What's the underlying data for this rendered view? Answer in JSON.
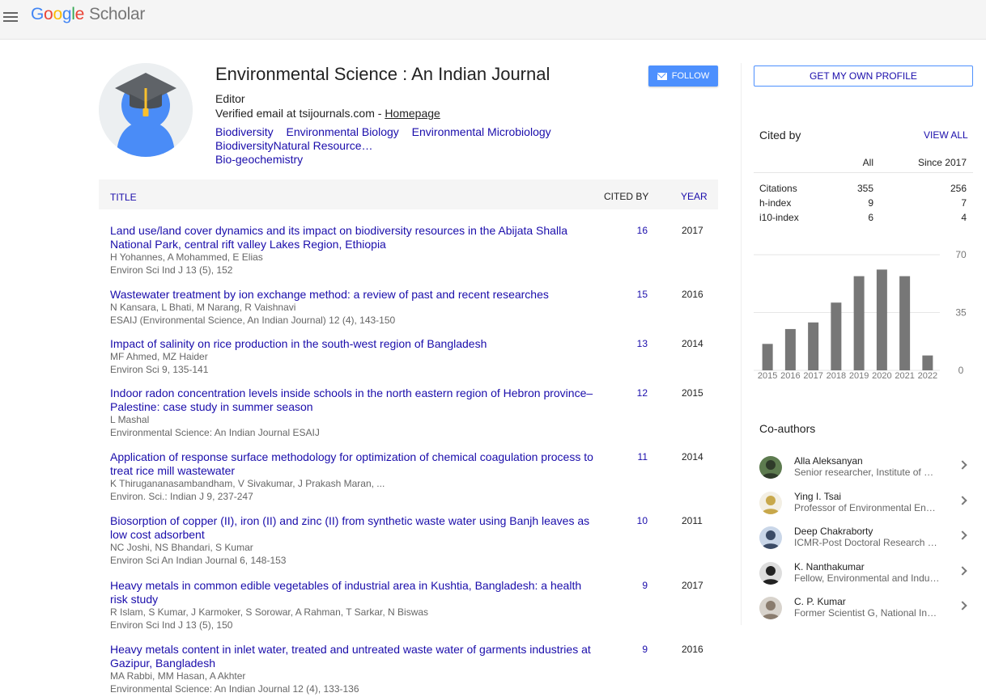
{
  "header": {
    "logo_google": [
      "G",
      "o",
      "o",
      "g",
      "l",
      "e"
    ],
    "logo_scholar": "Scholar"
  },
  "profile": {
    "name": "Environmental Science : An Indian Journal",
    "role": "Editor",
    "email_text": "Verified email at tsijournals.com - ",
    "homepage_label": "Homepage",
    "follow_label": "FOLLOW",
    "interests": [
      "Biodiversity",
      "Environmental Biology",
      "Environmental Microbiology",
      "BiodiversityNatural Resource…",
      "Bio-geochemistry"
    ]
  },
  "table": {
    "col_title": "TITLE",
    "col_cited": "CITED BY",
    "col_year": "YEAR",
    "rows": [
      {
        "title": "Land use/land cover dynamics and its impact on biodiversity resources in the Abijata Shalla National Park, central rift valley Lakes Region, Ethiopia",
        "authors": "H Yohannes, A Mohammed, E Elias",
        "venue": "Environ Sci Ind J 13 (5), 152",
        "cited": "16",
        "year": "2017"
      },
      {
        "title": "Wastewater treatment by ion exchange method: a review of past and recent researches",
        "authors": "N Kansara, L Bhati, M Narang, R Vaishnavi",
        "venue": "ESAIJ (Environmental Science, An Indian Journal) 12 (4), 143-150",
        "cited": "15",
        "year": "2016"
      },
      {
        "title": "Impact of salinity on rice production in the south-west region of Bangladesh",
        "authors": "MF Ahmed, MZ Haider",
        "venue": "Environ Sci 9, 135-141",
        "cited": "13",
        "year": "2014"
      },
      {
        "title": "Indoor radon concentration levels inside schools in the north eastern region of Hebron province–Palestine: case study in summer season",
        "authors": "L Mashal",
        "venue": "Environmental Science: An Indian Journal ESAIJ",
        "cited": "12",
        "year": "2015"
      },
      {
        "title": "Application of response surface methodology for optimization of chemical coagulation process to treat rice mill wastewater",
        "authors": "K Thirugananasambandham, V Sivakumar, J Prakash Maran, ...",
        "venue": "Environ. Sci.: Indian J 9, 237-247",
        "cited": "11",
        "year": "2014"
      },
      {
        "title": "Biosorption of copper (II), iron (II) and zinc (II) from synthetic waste water using Banjh leaves as low cost adsorbent",
        "authors": "NC Joshi, NS Bhandari, S Kumar",
        "venue": "Environ Sci An Indian Journal 6, 148-153",
        "cited": "10",
        "year": "2011"
      },
      {
        "title": "Heavy metals in common edible vegetables of industrial area in Kushtia, Bangladesh: a health risk study",
        "authors": "R Islam, S Kumar, J Karmoker, S Sorowar, A Rahman, T Sarkar, N Biswas",
        "venue": "Environ Sci Ind J 13 (5), 150",
        "cited": "9",
        "year": "2017"
      },
      {
        "title": "Heavy metals content in inlet water, treated and untreated waste water of garments industries at Gazipur, Bangladesh",
        "authors": "MA Rabbi, MM Hasan, A Akhter",
        "venue": "Environmental Science: An Indian Journal 12 (4), 133-136",
        "cited": "9",
        "year": "2016"
      }
    ]
  },
  "sidebar": {
    "own_profile_label": "GET MY OWN PROFILE",
    "cited_by_title": "Cited by",
    "view_all_label": "VIEW ALL",
    "stats_header": {
      "all": "All",
      "since": "Since 2017"
    },
    "stats": [
      {
        "label": "Citations",
        "all": "355",
        "since": "256"
      },
      {
        "label": "h-index",
        "all": "9",
        "since": "7"
      },
      {
        "label": "i10-index",
        "all": "6",
        "since": "4"
      }
    ],
    "coauthors_title": "Co-authors",
    "coauthors": [
      {
        "name": "Alla Aleksanyan",
        "affiliation": "Senior researcher, Institute of Botany"
      },
      {
        "name": "Ying I. Tsai",
        "affiliation": "Professor of Environmental Engineering"
      },
      {
        "name": "Deep Chakraborty",
        "affiliation": "ICMR-Post Doctoral Research Fellow"
      },
      {
        "name": "K. Nanthakumar",
        "affiliation": "Fellow, Environmental and Industrial"
      },
      {
        "name": "C. P. Kumar",
        "affiliation": "Former Scientist G, National Institute"
      }
    ]
  },
  "chart_data": {
    "type": "bar",
    "categories": [
      "2015",
      "2016",
      "2017",
      "2018",
      "2019",
      "2020",
      "2021",
      "2022"
    ],
    "values": [
      16,
      25,
      29,
      41,
      57,
      61,
      57,
      9
    ],
    "yticks": [
      0,
      35,
      70
    ],
    "ylim": [
      0,
      70
    ],
    "bar_color": "#777777"
  }
}
